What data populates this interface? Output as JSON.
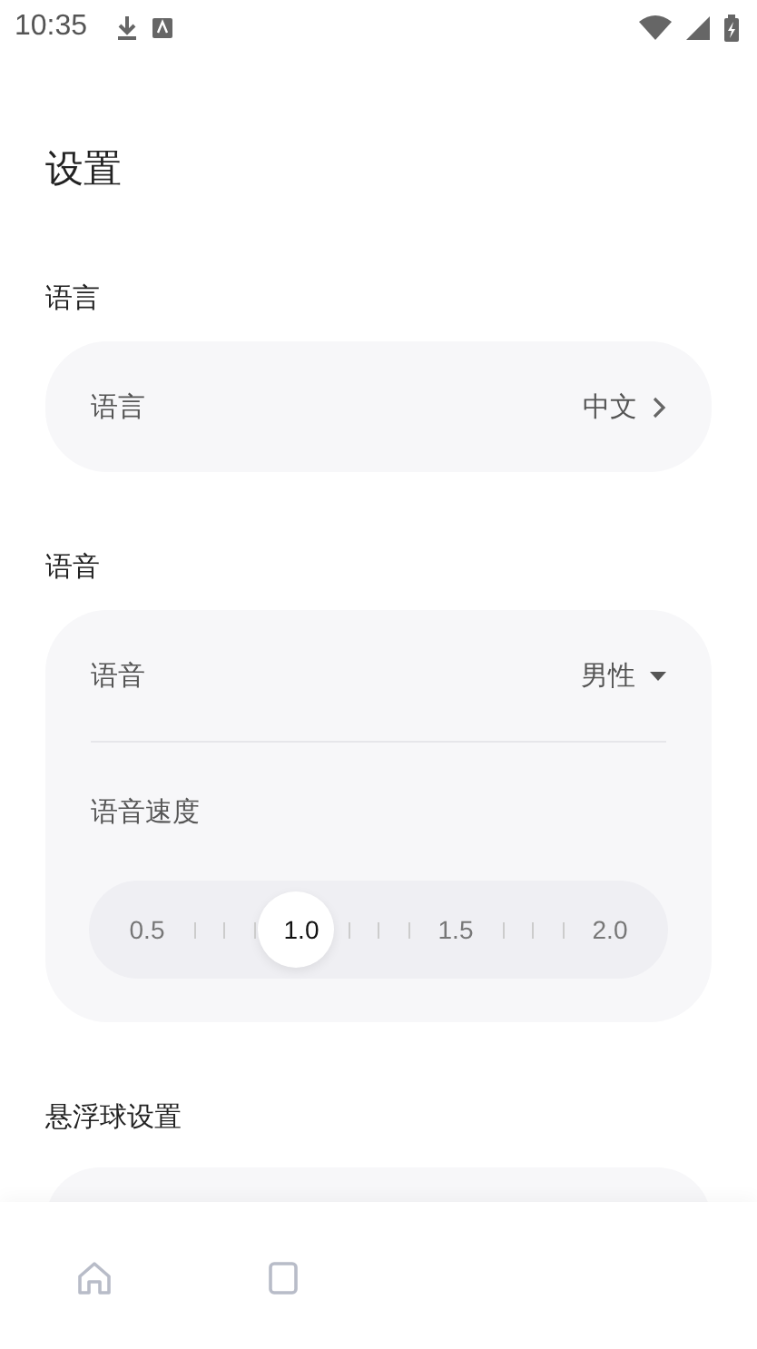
{
  "status_bar": {
    "time": "10:35"
  },
  "title": "设置",
  "sections": [
    {
      "heading": "语言",
      "rows": [
        {
          "kind": "link",
          "label": "语言",
          "value": "中文"
        }
      ]
    },
    {
      "heading": "语音",
      "rows": [
        {
          "kind": "dropdown",
          "label": "语音",
          "value": "男性"
        },
        {
          "kind": "slider",
          "label": "语音速度",
          "level": 0.333,
          "marks": [
            {
              "label": "0.5",
              "selected": false
            },
            {
              "label": "1.0",
              "selected": true
            },
            {
              "label": "1.5",
              "selected": false
            },
            {
              "label": "2.0",
              "selected": false
            }
          ]
        }
      ]
    },
    {
      "heading": "悬浮球设置"
    }
  ]
}
